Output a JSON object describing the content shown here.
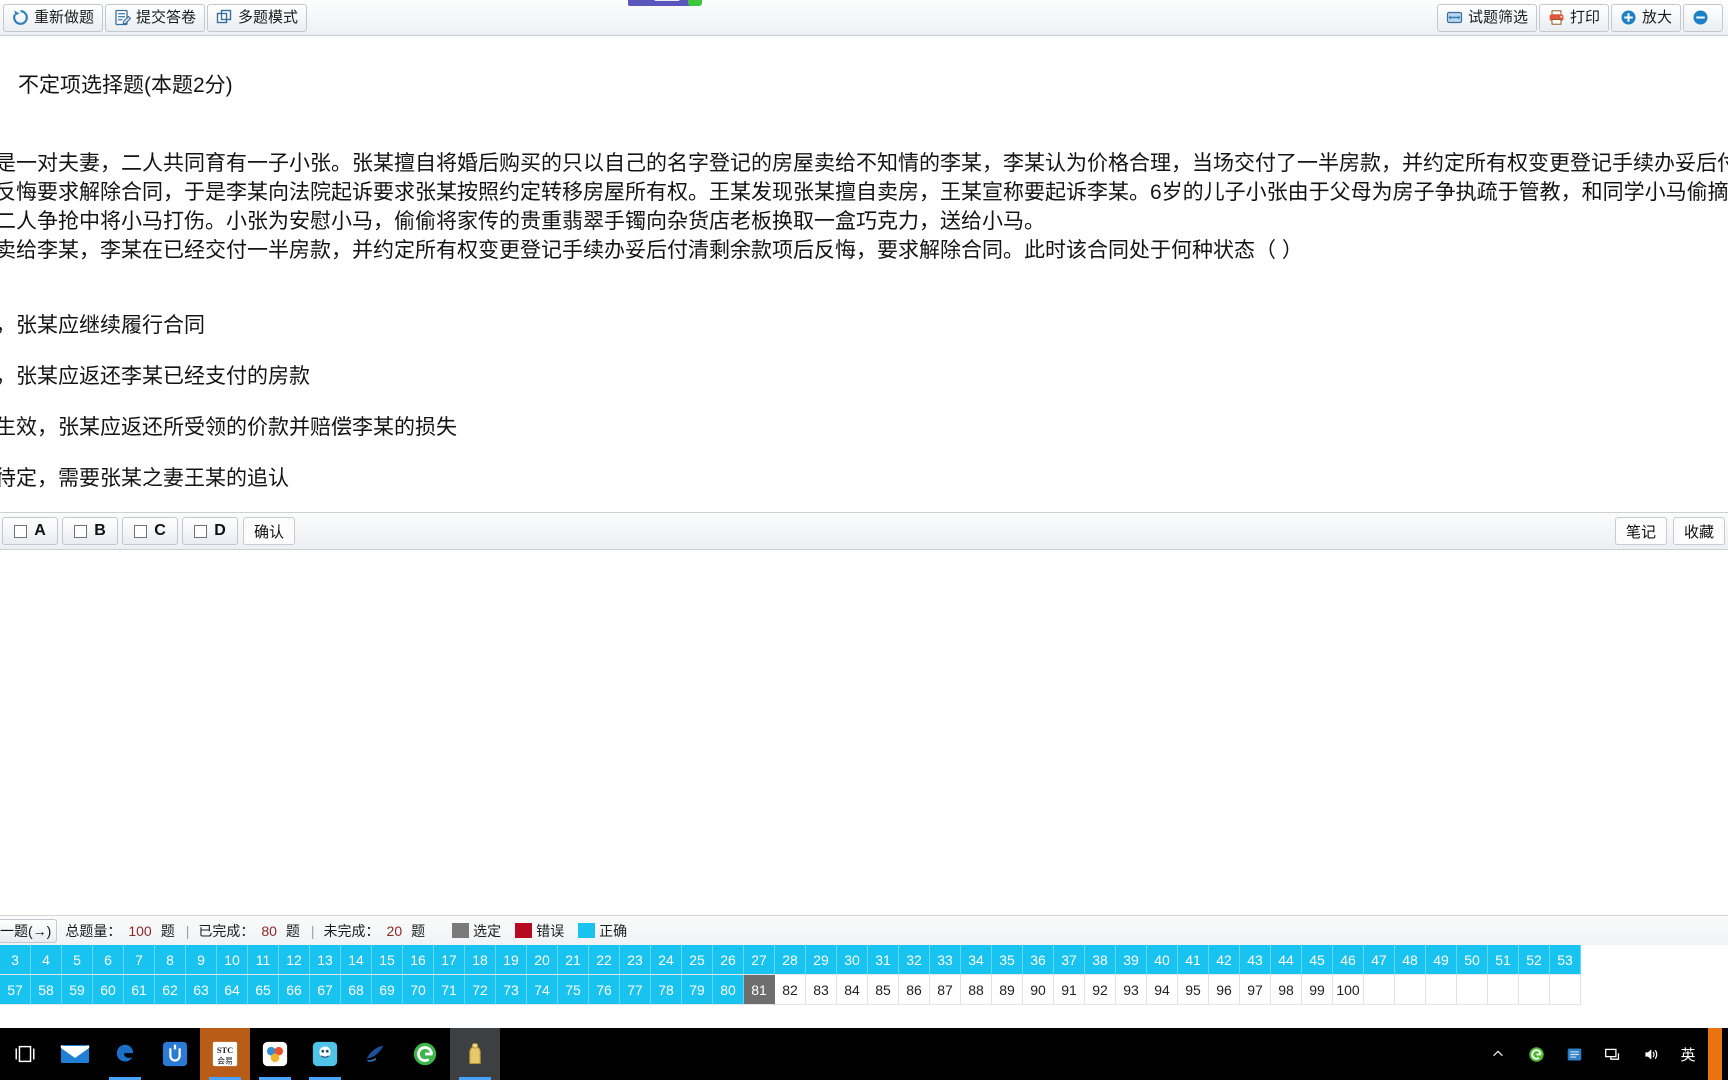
{
  "toolbar": {
    "left_buttons": [
      {
        "label": "重新做题",
        "icon": "refresh-icon"
      },
      {
        "label": "提交答卷",
        "icon": "submit-paper-icon"
      },
      {
        "label": "多题模式",
        "icon": "multi-question-icon"
      }
    ],
    "right_buttons": [
      {
        "label": "试题筛选",
        "icon": "filter-icon"
      },
      {
        "label": "打印",
        "icon": "printer-icon"
      },
      {
        "label": "放大",
        "icon": "zoom-in-icon"
      },
      {
        "label": "",
        "icon": "zoom-out-icon"
      }
    ]
  },
  "question": {
    "title": "不定项选择题(本题2分)",
    "stem_lines": [
      "某是一对夫妻，二人共同育有一子小张。张某擅自将婚后购买的只以自己的名字登记的房屋卖给不知情的李某，李某认为价格合理，当场交付了一半房款，并约定所有权变更登记手续办妥后付清剩余",
      "某反悔要求解除合同，于是李某向法院起诉要求张某按照约定转移房屋所有权。王某发现张某擅自卖房，王某宣称要起诉李某。6岁的儿子小张由于父母为房子争执疏于管教，和同学小马偷摘邻居种",
      "，二人争抢中将小马打伤。小张为安慰小马，偷偷将家传的贵重翡翠手镯向杂货店老板换取一盒巧克力，送给小马。",
      "屋卖给李某，李某在已经交付一半房款，并约定所有权变更登记手续办妥后付清剩余款项后反悔，要求解除合同。此时该合同处于何种状态（ ）"
    ],
    "options": [
      "效，张某应继续履行合同",
      "效，张某应返还李某已经支付的房款",
      "未生效，张某应返还所受领的价款并赔偿李某的损失",
      "力待定，需要张某之妻王某的追认"
    ]
  },
  "answer_bar": {
    "choices": [
      {
        "label": "A",
        "checked": false
      },
      {
        "label": "B",
        "checked": false
      },
      {
        "label": "C",
        "checked": false
      },
      {
        "label": "D",
        "checked": false
      }
    ],
    "confirm_label": "确认",
    "note_label": "笔记",
    "favorite_label": "收藏"
  },
  "status": {
    "nav_label": "一题(→)",
    "total_label": "总题量：",
    "total_value": "100",
    "total_unit": "题",
    "done_label": "已完成：",
    "done_value": "80",
    "done_unit": "题",
    "undone_label": "未完成：",
    "undone_value": "20",
    "undone_unit": "题",
    "divider": "|",
    "legend": [
      {
        "label": "选定",
        "color": "#7a7a7a"
      },
      {
        "label": "错误",
        "color": "#b60a22"
      },
      {
        "label": "正确",
        "color": "#18c3ef"
      }
    ]
  },
  "grid": {
    "row1": [
      {
        "n": "3",
        "state": "correct"
      },
      {
        "n": "4",
        "state": "correct"
      },
      {
        "n": "5",
        "state": "correct"
      },
      {
        "n": "6",
        "state": "correct"
      },
      {
        "n": "7",
        "state": "correct"
      },
      {
        "n": "8",
        "state": "correct"
      },
      {
        "n": "9",
        "state": "correct"
      },
      {
        "n": "10",
        "state": "correct"
      },
      {
        "n": "11",
        "state": "correct"
      },
      {
        "n": "12",
        "state": "correct"
      },
      {
        "n": "13",
        "state": "correct"
      },
      {
        "n": "14",
        "state": "correct"
      },
      {
        "n": "15",
        "state": "correct"
      },
      {
        "n": "16",
        "state": "correct"
      },
      {
        "n": "17",
        "state": "correct"
      },
      {
        "n": "18",
        "state": "correct"
      },
      {
        "n": "19",
        "state": "correct"
      },
      {
        "n": "20",
        "state": "correct"
      },
      {
        "n": "21",
        "state": "correct"
      },
      {
        "n": "22",
        "state": "correct"
      },
      {
        "n": "23",
        "state": "correct"
      },
      {
        "n": "24",
        "state": "correct"
      },
      {
        "n": "25",
        "state": "correct"
      },
      {
        "n": "26",
        "state": "correct"
      },
      {
        "n": "27",
        "state": "correct"
      },
      {
        "n": "28",
        "state": "correct"
      },
      {
        "n": "29",
        "state": "correct"
      },
      {
        "n": "30",
        "state": "correct"
      },
      {
        "n": "31",
        "state": "correct"
      },
      {
        "n": "32",
        "state": "correct"
      },
      {
        "n": "33",
        "state": "correct"
      },
      {
        "n": "34",
        "state": "correct"
      },
      {
        "n": "35",
        "state": "correct"
      },
      {
        "n": "36",
        "state": "correct"
      },
      {
        "n": "37",
        "state": "correct"
      },
      {
        "n": "38",
        "state": "correct"
      },
      {
        "n": "39",
        "state": "correct"
      },
      {
        "n": "40",
        "state": "correct"
      },
      {
        "n": "41",
        "state": "correct"
      },
      {
        "n": "42",
        "state": "correct"
      },
      {
        "n": "43",
        "state": "correct"
      },
      {
        "n": "44",
        "state": "correct"
      },
      {
        "n": "45",
        "state": "correct"
      },
      {
        "n": "46",
        "state": "correct"
      },
      {
        "n": "47",
        "state": "correct"
      },
      {
        "n": "48",
        "state": "correct"
      },
      {
        "n": "49",
        "state": "correct"
      },
      {
        "n": "50",
        "state": "correct"
      },
      {
        "n": "51",
        "state": "correct"
      },
      {
        "n": "52",
        "state": "correct"
      },
      {
        "n": "53",
        "state": "correct"
      }
    ],
    "row2": [
      {
        "n": "57",
        "state": "correct"
      },
      {
        "n": "58",
        "state": "correct"
      },
      {
        "n": "59",
        "state": "correct"
      },
      {
        "n": "60",
        "state": "correct"
      },
      {
        "n": "61",
        "state": "correct"
      },
      {
        "n": "62",
        "state": "correct"
      },
      {
        "n": "63",
        "state": "correct"
      },
      {
        "n": "64",
        "state": "correct"
      },
      {
        "n": "65",
        "state": "correct"
      },
      {
        "n": "66",
        "state": "correct"
      },
      {
        "n": "67",
        "state": "correct"
      },
      {
        "n": "68",
        "state": "correct"
      },
      {
        "n": "69",
        "state": "correct"
      },
      {
        "n": "70",
        "state": "correct"
      },
      {
        "n": "71",
        "state": "correct"
      },
      {
        "n": "72",
        "state": "correct"
      },
      {
        "n": "73",
        "state": "correct"
      },
      {
        "n": "74",
        "state": "correct"
      },
      {
        "n": "75",
        "state": "correct"
      },
      {
        "n": "76",
        "state": "correct"
      },
      {
        "n": "77",
        "state": "correct"
      },
      {
        "n": "78",
        "state": "correct"
      },
      {
        "n": "79",
        "state": "correct"
      },
      {
        "n": "80",
        "state": "correct"
      },
      {
        "n": "81",
        "state": "current"
      },
      {
        "n": "82",
        "state": "empty"
      },
      {
        "n": "83",
        "state": "empty"
      },
      {
        "n": "84",
        "state": "empty"
      },
      {
        "n": "85",
        "state": "empty"
      },
      {
        "n": "86",
        "state": "empty"
      },
      {
        "n": "87",
        "state": "empty"
      },
      {
        "n": "88",
        "state": "empty"
      },
      {
        "n": "89",
        "state": "empty"
      },
      {
        "n": "90",
        "state": "empty"
      },
      {
        "n": "91",
        "state": "empty"
      },
      {
        "n": "92",
        "state": "empty"
      },
      {
        "n": "93",
        "state": "empty"
      },
      {
        "n": "94",
        "state": "empty"
      },
      {
        "n": "95",
        "state": "empty"
      },
      {
        "n": "96",
        "state": "empty"
      },
      {
        "n": "97",
        "state": "empty"
      },
      {
        "n": "98",
        "state": "empty"
      },
      {
        "n": "99",
        "state": "empty"
      },
      {
        "n": "100",
        "state": "empty"
      },
      {
        "n": "",
        "state": "blankcell"
      },
      {
        "n": "",
        "state": "blankcell"
      },
      {
        "n": "",
        "state": "blankcell"
      },
      {
        "n": "",
        "state": "blankcell"
      },
      {
        "n": "",
        "state": "blankcell"
      },
      {
        "n": "",
        "state": "blankcell"
      },
      {
        "n": "",
        "state": "blankcell"
      }
    ]
  },
  "taskbar": {
    "items": [
      {
        "name": "task-view-icon"
      },
      {
        "name": "mail-icon"
      },
      {
        "name": "edge-browser-icon"
      },
      {
        "name": "u-app-icon"
      },
      {
        "name": "stc-app-icon"
      },
      {
        "name": "colorful-app-icon"
      },
      {
        "name": "blue-character-app-icon"
      },
      {
        "name": "dark-blue-app-icon"
      },
      {
        "name": "green-browser-icon"
      },
      {
        "name": "gold-app-icon"
      }
    ],
    "tray": [
      {
        "name": "chevron-up-icon",
        "label": "⌃"
      },
      {
        "name": "green-circle-icon",
        "label": ""
      },
      {
        "name": "blue-tray-icon",
        "label": ""
      },
      {
        "name": "network-icon",
        "label": ""
      },
      {
        "name": "volume-icon",
        "label": ""
      },
      {
        "name": "ime-indicator",
        "label": "英"
      }
    ]
  }
}
